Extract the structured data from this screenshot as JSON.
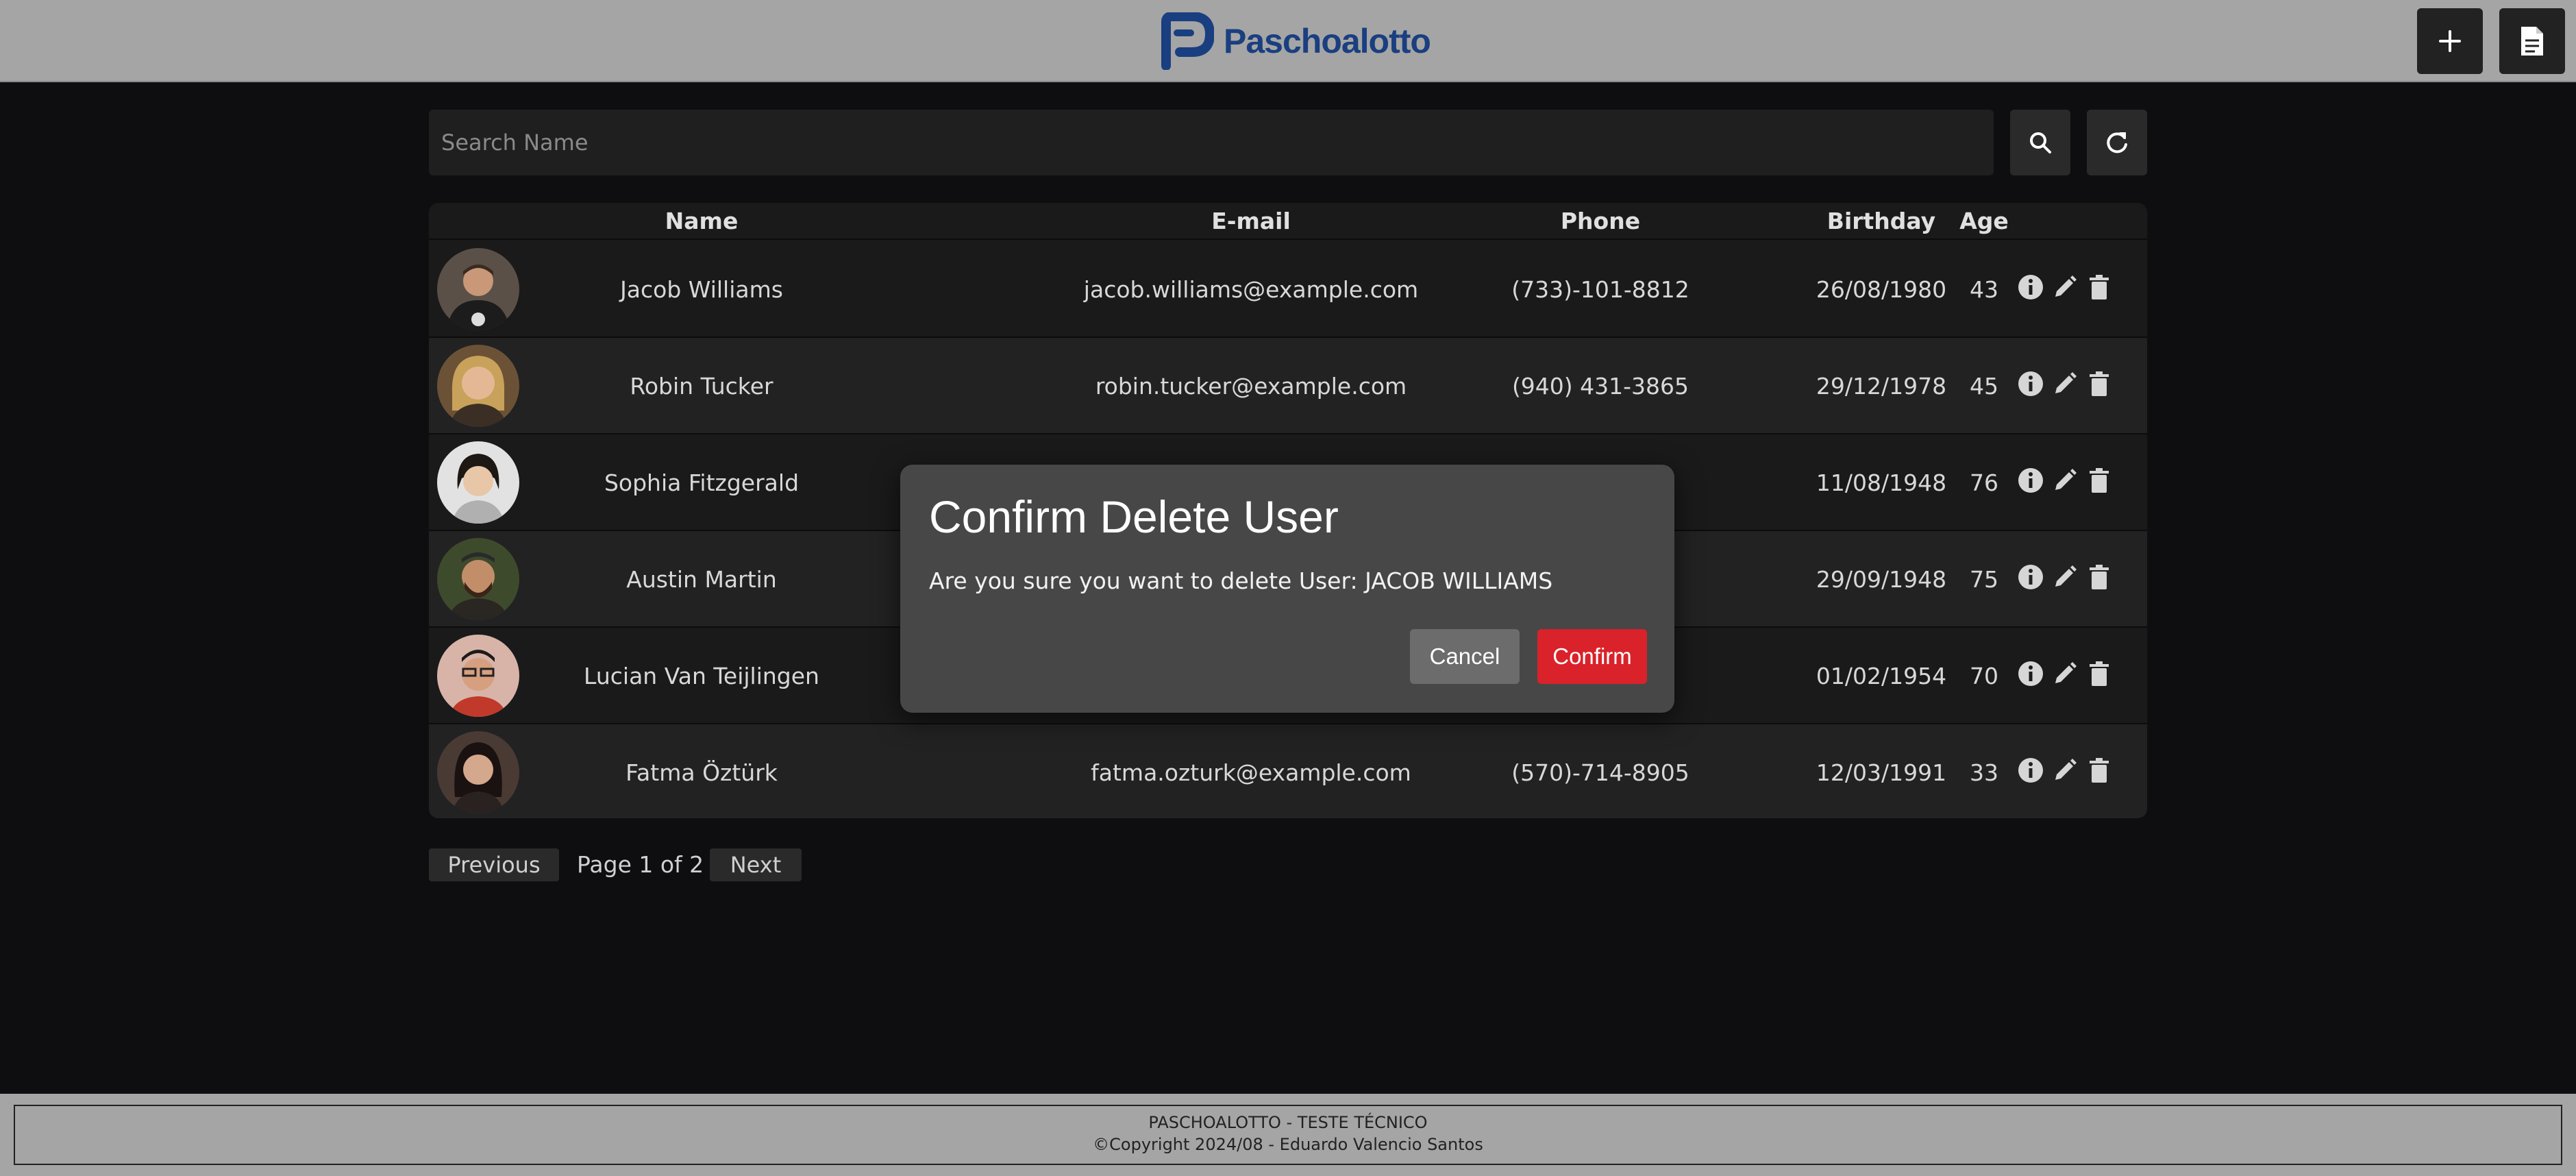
{
  "header": {
    "brand": "Paschoalotto",
    "add_icon": "plus-icon",
    "report_icon": "document-icon"
  },
  "search": {
    "placeholder": "Search Name",
    "value": "",
    "search_icon": "magnifier-icon",
    "refresh_icon": "refresh-icon"
  },
  "table": {
    "columns": [
      "Name",
      "E-mail",
      "Phone",
      "Birthday",
      "Age"
    ],
    "rows": [
      {
        "name": "Jacob Williams",
        "email": "jacob.williams@example.com",
        "phone": "(733)-101-8812",
        "birthday": "26/08/1980",
        "age": "43"
      },
      {
        "name": "Robin Tucker",
        "email": "robin.tucker@example.com",
        "phone": "(940) 431-3865",
        "birthday": "29/12/1978",
        "age": "45"
      },
      {
        "name": "Sophia Fitzgerald",
        "email": "",
        "phone": "",
        "birthday": "11/08/1948",
        "age": "76"
      },
      {
        "name": "Austin Martin",
        "email": "",
        "phone": "",
        "birthday": "29/09/1948",
        "age": "75"
      },
      {
        "name": "Lucian Van Teijlingen",
        "email": "",
        "phone": "",
        "birthday": "01/02/1954",
        "age": "70"
      },
      {
        "name": "Fatma Öztürk",
        "email": "fatma.ozturk@example.com",
        "phone": "(570)-714-8905",
        "birthday": "12/03/1991",
        "age": "33"
      }
    ],
    "action_icons": [
      "info-icon",
      "edit-pencil-icon",
      "trash-icon"
    ]
  },
  "pagination": {
    "previous": "Previous",
    "info": "Page 1 of 2",
    "next": "Next"
  },
  "modal": {
    "title": "Confirm Delete User",
    "message": "Are you sure you want to delete User: JACOB WILLIAMS",
    "cancel": "Cancel",
    "confirm": "Confirm"
  },
  "footer": {
    "line1": "PASCHOALOTTO - TESTE TÉCNICO",
    "line2": "©Copyright 2024/08 - Eduardo Valencio Santos"
  },
  "colors": {
    "header_bg": "#a5a5a5",
    "page_bg": "#0e0e10",
    "brand_blue": "#1a3f80",
    "confirm_red": "#d9222a",
    "cancel_gray": "#6c6c6c",
    "modal_bg": "#474747"
  }
}
